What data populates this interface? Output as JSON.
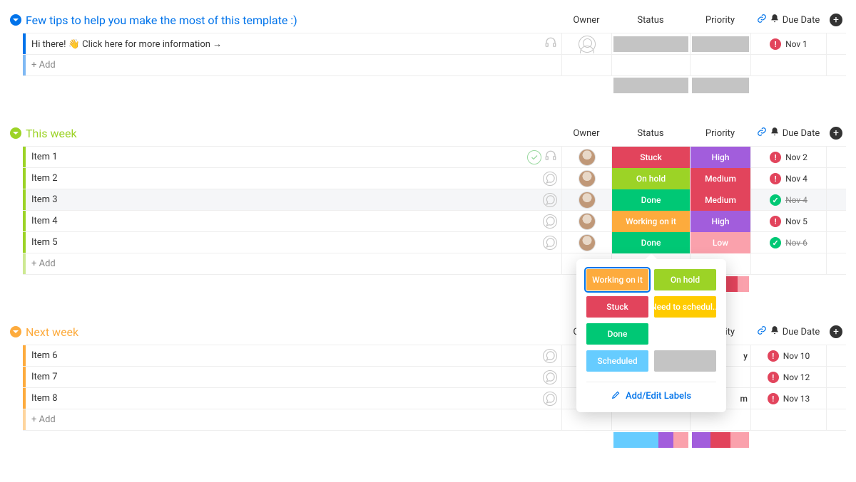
{
  "columns": {
    "owner": "Owner",
    "status": "Status",
    "priority": "Priority",
    "due_date": "Due Date"
  },
  "add_row_label": "+ Add",
  "status_popover": {
    "options": [
      {
        "label": "Working on it",
        "color": "#fdab3d",
        "selected": true
      },
      {
        "label": "On hold",
        "color": "#9cd326"
      },
      {
        "label": "Stuck",
        "color": "#e2445c"
      },
      {
        "label": "Need to schedul...",
        "color": "#ffcb00"
      },
      {
        "label": "Done",
        "color": "#00c875"
      },
      {
        "label": "",
        "color": "#ffffff",
        "empty_slot": true
      },
      {
        "label": "Scheduled",
        "color": "#66ccff"
      },
      {
        "label": "",
        "color": "#c4c4c4",
        "blank": true
      }
    ],
    "footer_label": "Add/Edit Labels"
  },
  "groups": [
    {
      "id": "tips",
      "title": "Few tips to help you make the most of this template :)",
      "color": "#0073ea",
      "rows": [
        {
          "name": "Hi there! 👋 Click here for more information →",
          "name_icons": [
            "headset"
          ],
          "owner": "empty",
          "status": {
            "label": "",
            "color": "#c4c4c4",
            "is_grey_block": true
          },
          "priority": {
            "label": "",
            "color": "#c4c4c4",
            "is_grey_block": true
          },
          "due_date": {
            "text": "Nov 1",
            "icon": "warn"
          }
        }
      ],
      "summary": {
        "status": [
          {
            "color": "#c4c4c4",
            "pct": 100
          }
        ],
        "priority": [
          {
            "color": "#c4c4c4",
            "pct": 100
          }
        ]
      }
    },
    {
      "id": "this_week",
      "title": "This week",
      "color": "#9cd326",
      "rows": [
        {
          "name": "Item 1",
          "name_icons": [
            "check",
            "headset"
          ],
          "owner": "avatar",
          "status": {
            "label": "Stuck",
            "color": "#e2445c"
          },
          "priority": {
            "label": "High",
            "color": "#a25ddc"
          },
          "due_date": {
            "text": "Nov 2",
            "icon": "warn"
          }
        },
        {
          "name": "Item 2",
          "name_icons": [
            "bubble"
          ],
          "owner": "avatar",
          "status": {
            "label": "On hold",
            "color": "#9cd326"
          },
          "priority": {
            "label": "Medium",
            "color": "#e2445c"
          },
          "due_date": {
            "text": "Nov 4",
            "icon": "warn"
          }
        },
        {
          "name": "Item 3",
          "name_icons": [
            "bubble"
          ],
          "owner": "avatar",
          "highlight": true,
          "status": {
            "label": "Done",
            "color": "#00c875"
          },
          "priority": {
            "label": "Medium",
            "color": "#e2445c"
          },
          "due_date": {
            "text": "Nov 4",
            "icon": "ok",
            "strike": true
          }
        },
        {
          "name": "Item 4",
          "name_icons": [
            "bubble"
          ],
          "owner": "avatar",
          "status": {
            "label": "Working on it",
            "color": "#fdab3d"
          },
          "priority": {
            "label": "High",
            "color": "#a25ddc"
          },
          "due_date": {
            "text": "Nov 5",
            "icon": "warn"
          }
        },
        {
          "name": "Item 5",
          "name_icons": [
            "bubble"
          ],
          "owner": "avatar",
          "status": {
            "label": "Done",
            "color": "#00c875",
            "show_popover": true
          },
          "priority": {
            "label": "Low",
            "color": "#faa1ac"
          },
          "due_date": {
            "text": "Nov 6",
            "icon": "ok",
            "strike": true
          }
        }
      ],
      "summary": {
        "status": [
          {
            "color": "#66ccff",
            "pct": 40
          },
          {
            "color": "#a25ddc",
            "pct": 20
          },
          {
            "color": "#e2445c",
            "pct": 20
          },
          {
            "color": "#faa1ac",
            "pct": 20
          }
        ],
        "priority": [
          {
            "color": "#a25ddc",
            "pct": 40
          },
          {
            "color": "#e2445c",
            "pct": 40
          },
          {
            "color": "#faa1ac",
            "pct": 20
          }
        ]
      }
    },
    {
      "id": "next_week",
      "title": "Next week",
      "color": "#fdab3d",
      "rows": [
        {
          "name": "Item 6",
          "name_icons": [
            "bubble"
          ],
          "owner": "",
          "status": {
            "label": "",
            "color": "",
            "hidden": true
          },
          "priority": {
            "label": "",
            "color": "",
            "hidden": true,
            "trailing": "y"
          },
          "due_date": {
            "text": "Nov 10",
            "icon": "warn"
          }
        },
        {
          "name": "Item 7",
          "name_icons": [
            "bubble"
          ],
          "owner": "",
          "status": {
            "label": "",
            "color": "",
            "hidden": true
          },
          "priority": {
            "label": "",
            "color": "",
            "hidden": true
          },
          "due_date": {
            "text": "Nov 12",
            "icon": "warn"
          }
        },
        {
          "name": "Item 8",
          "name_icons": [
            "bubble"
          ],
          "owner": "",
          "status": {
            "label": "",
            "color": "",
            "hidden": true
          },
          "priority": {
            "label": "",
            "color": "",
            "hidden": true,
            "trailing": "m"
          },
          "due_date": {
            "text": "Nov 13",
            "icon": "warn"
          }
        }
      ],
      "summary": {
        "status": [
          {
            "color": "#66ccff",
            "pct": 60
          },
          {
            "color": "#a25ddc",
            "pct": 20
          },
          {
            "color": "#faa1ac",
            "pct": 20
          }
        ],
        "priority": [
          {
            "color": "#a25ddc",
            "pct": 33
          },
          {
            "color": "#e2445c",
            "pct": 34
          },
          {
            "color": "#faa1ac",
            "pct": 33
          }
        ]
      }
    }
  ]
}
